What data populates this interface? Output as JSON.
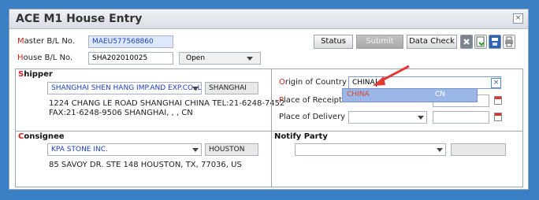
{
  "window": {
    "title": "ACE M1 House Entry",
    "close_icon": "close-icon"
  },
  "master_bl": {
    "label_first": "M",
    "label_rest": "aster B/L No.",
    "value": "MAEU577568860"
  },
  "house_bl": {
    "label_first": "H",
    "label_rest": "ouse B/L No.",
    "value": "SHA202010025",
    "status": "Open"
  },
  "toolbar": {
    "status": "Status",
    "submit": "Submit",
    "data_check": "Data Check"
  },
  "shipper": {
    "title_first": "S",
    "title_rest": "hipper",
    "name": "SHANGHAI SHEN HANG IMP.AND EXP.CO.,LTD",
    "city": "SHANGHAI",
    "address_line1": "1224 CHANG LE ROAD SHANGHAI CHINA TEL:21-6248-7452",
    "address_line2": "FAX:21-6248-9506 SHANGHAI, , , CN"
  },
  "origin": {
    "label_first": "O",
    "label_rest": "rigin of Country",
    "value": "CHINA",
    "suggestion_name": "CHINA",
    "suggestion_code": "CN"
  },
  "receipt": {
    "label_first": "P",
    "label_rest": "lace of Receipt"
  },
  "delivery": {
    "label": "Place of Delivery"
  },
  "consignee": {
    "title_first": "C",
    "title_rest": "onsignee",
    "name": "KPA STONE INC.",
    "city": "HOUSTON",
    "address": "85 SAVOY DR. STE 148 HOUSTON, TX, 77036, US"
  },
  "notify": {
    "title": "Notify Party"
  },
  "colors": {
    "background": "#3b7fc4",
    "required_label": "#d32121",
    "accent_blue": "#1d3fb8",
    "annotation_arrow": "#e53935"
  }
}
